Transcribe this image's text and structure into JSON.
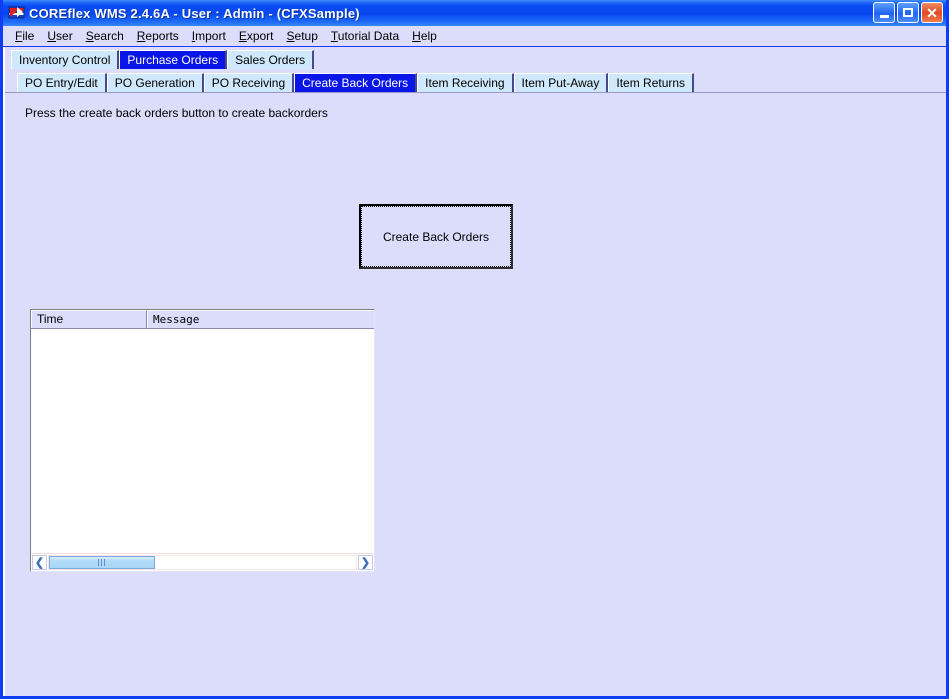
{
  "window": {
    "title": "COREflex WMS 2.4.6A - User : Admin - (CFXSample)",
    "icon": "flag-icon",
    "buttons": {
      "minimize": "minimize-icon",
      "maximize": "maximize-icon",
      "close": "✕"
    }
  },
  "menu": {
    "items": [
      {
        "label": "File",
        "accel": "F"
      },
      {
        "label": "User",
        "accel": "U"
      },
      {
        "label": "Search",
        "accel": "S"
      },
      {
        "label": "Reports",
        "accel": "R"
      },
      {
        "label": "Import",
        "accel": "I"
      },
      {
        "label": "Export",
        "accel": "E"
      },
      {
        "label": "Setup",
        "accel": "S"
      },
      {
        "label": "Tutorial Data",
        "accel": "T"
      },
      {
        "label": "Help",
        "accel": "H"
      }
    ]
  },
  "main_tabs": {
    "items": [
      {
        "label": "Inventory Control",
        "selected": false
      },
      {
        "label": "Purchase Orders",
        "selected": true
      },
      {
        "label": "Sales Orders",
        "selected": false
      }
    ]
  },
  "sub_tabs": {
    "items": [
      {
        "label": "PO Entry/Edit",
        "selected": false
      },
      {
        "label": "PO Generation",
        "selected": false
      },
      {
        "label": "PO Receiving",
        "selected": false
      },
      {
        "label": "Create Back Orders",
        "selected": true
      },
      {
        "label": "Item Receiving",
        "selected": false
      },
      {
        "label": "Item Put-Away",
        "selected": false
      },
      {
        "label": "Item Returns",
        "selected": false
      }
    ]
  },
  "panel": {
    "instruction": "Press the create back orders button to create backorders",
    "action_button_label": "Create Back Orders"
  },
  "grid": {
    "columns": [
      "Time",
      "Message"
    ],
    "rows": [],
    "scroll": {
      "left_arrow": "❮",
      "right_arrow": "❯"
    }
  },
  "colors": {
    "titlebar_blue": "#0a4cf3",
    "window_border": "#0f3df7",
    "background": "#dcdcfb",
    "tab_inactive": "#cfe8fb",
    "tab_selected": "#0a16e8",
    "grid_white": "#ffffff",
    "scroll_thumb": "#a8d6f7"
  }
}
